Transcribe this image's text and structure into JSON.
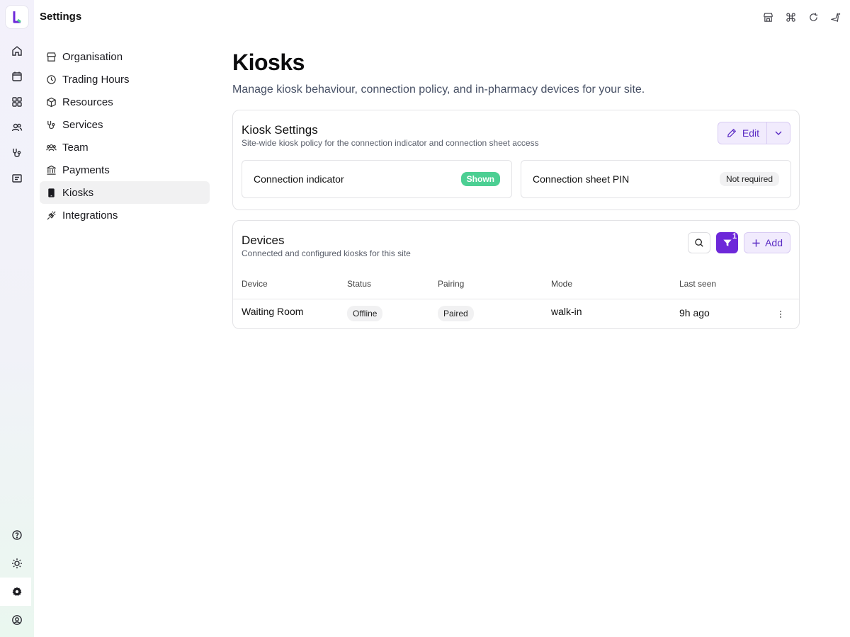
{
  "app": {
    "title": "Settings"
  },
  "rail": {
    "items": [
      "home-icon",
      "calendar-icon",
      "grid-icon",
      "users-icon",
      "stethoscope-icon",
      "messages-icon"
    ],
    "bottom": [
      "help-icon",
      "sun-icon",
      "settings-icon",
      "account-icon"
    ]
  },
  "topbar": {
    "icons": [
      "store-icon",
      "command-icon",
      "refresh-icon",
      "sparkle-icon"
    ]
  },
  "nav": {
    "items": [
      {
        "label": "Organisation",
        "icon": "store-icon"
      },
      {
        "label": "Trading Hours",
        "icon": "clock-icon"
      },
      {
        "label": "Resources",
        "icon": "box-icon"
      },
      {
        "label": "Services",
        "icon": "stethoscope-icon"
      },
      {
        "label": "Team",
        "icon": "team-icon"
      },
      {
        "label": "Payments",
        "icon": "bank-icon"
      },
      {
        "label": "Kiosks",
        "icon": "tablet-icon",
        "active": true
      },
      {
        "label": "Integrations",
        "icon": "plug-icon"
      }
    ]
  },
  "page": {
    "title": "Kiosks",
    "subtitle": "Manage kiosk behaviour, connection policy, and in-pharmacy devices for your site."
  },
  "kiosk_settings": {
    "title": "Kiosk Settings",
    "subtitle": "Site-wide kiosk policy for the connection indicator and connection sheet access",
    "edit_label": "Edit",
    "connection_indicator": {
      "label": "Connection indicator",
      "value": "Shown"
    },
    "connection_pin": {
      "label": "Connection sheet PIN",
      "value": "Not required"
    }
  },
  "devices": {
    "title": "Devices",
    "subtitle": "Connected and configured kiosks for this site",
    "filter_count": "1",
    "add_label": "Add",
    "columns": [
      "Device",
      "Status",
      "Pairing",
      "Mode",
      "Last seen"
    ],
    "rows": [
      {
        "device": "Waiting Room",
        "status": "Offline",
        "pairing": "Paired",
        "mode": "walk-in",
        "last_seen": "9h ago"
      }
    ]
  },
  "colors": {
    "accent": "#6d28d9",
    "accent_soft": "#f1ebfd",
    "success": "#4ccf93"
  }
}
